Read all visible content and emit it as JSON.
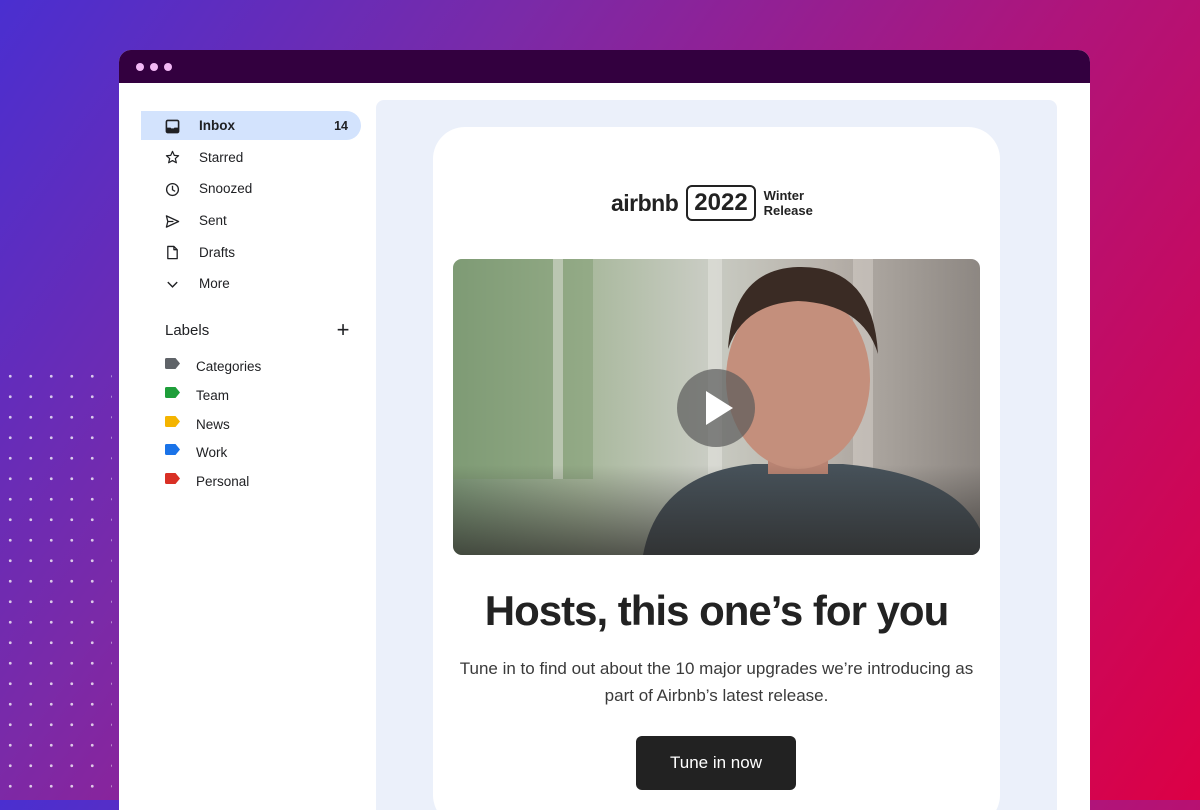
{
  "sidebar": {
    "items": [
      {
        "label": "Inbox",
        "count": "14",
        "icon": "inbox-icon"
      },
      {
        "label": "Starred",
        "icon": "star-icon"
      },
      {
        "label": "Snoozed",
        "icon": "clock-icon"
      },
      {
        "label": "Sent",
        "icon": "send-icon"
      },
      {
        "label": "Drafts",
        "icon": "draft-icon"
      },
      {
        "label": "More",
        "icon": "chevron-down-icon"
      }
    ],
    "labels_title": "Labels",
    "add_label": "+",
    "labels": [
      {
        "label": "Categories",
        "color": "#5f6368"
      },
      {
        "label": "Team",
        "color": "#1e9e3a"
      },
      {
        "label": "News",
        "color": "#f4b400"
      },
      {
        "label": "Work",
        "color": "#1a73e8"
      },
      {
        "label": "Personal",
        "color": "#d93025"
      }
    ]
  },
  "email": {
    "brand_name": "airbnb",
    "brand_year": "2022",
    "brand_release": "Winter Release",
    "headline": "Hosts, this one’s for you",
    "body": "Tune in to find out about the 10 major upgrades we’re introducing as part of Airbnb’s latest release.",
    "cta_label": "Tune in now"
  },
  "colors": {
    "titlebar": "#33003f",
    "active_item": "#d3e3fd",
    "reading_pane": "#ebf0fa",
    "cta": "#222222"
  }
}
